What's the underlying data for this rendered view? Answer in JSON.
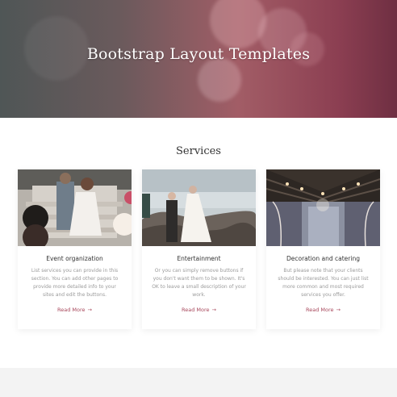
{
  "hero": {
    "title": "Bootstrap Layout Templates"
  },
  "services": {
    "title": "Services",
    "cards": [
      {
        "title": "Event organization",
        "text": "List services you can provide in this section. You can add other pages to provide more detailed info to your sites and edit the buttons.",
        "link": "Read More"
      },
      {
        "title": "Entertainment",
        "text": "Or you can simply remove buttons if you don't want them to be shown. It's OK to leave a small description of your work.",
        "link": "Read More"
      },
      {
        "title": "Decoration and catering",
        "text": "But please note that your clients should be interested. You can just list more common and most required services you offer.",
        "link": "Read More"
      }
    ]
  },
  "colors": {
    "accent": "#a8485c",
    "hero_left": "#4f5656",
    "hero_right": "#8c3f52"
  },
  "icons": {
    "read_more": "arrow-right-icon"
  }
}
